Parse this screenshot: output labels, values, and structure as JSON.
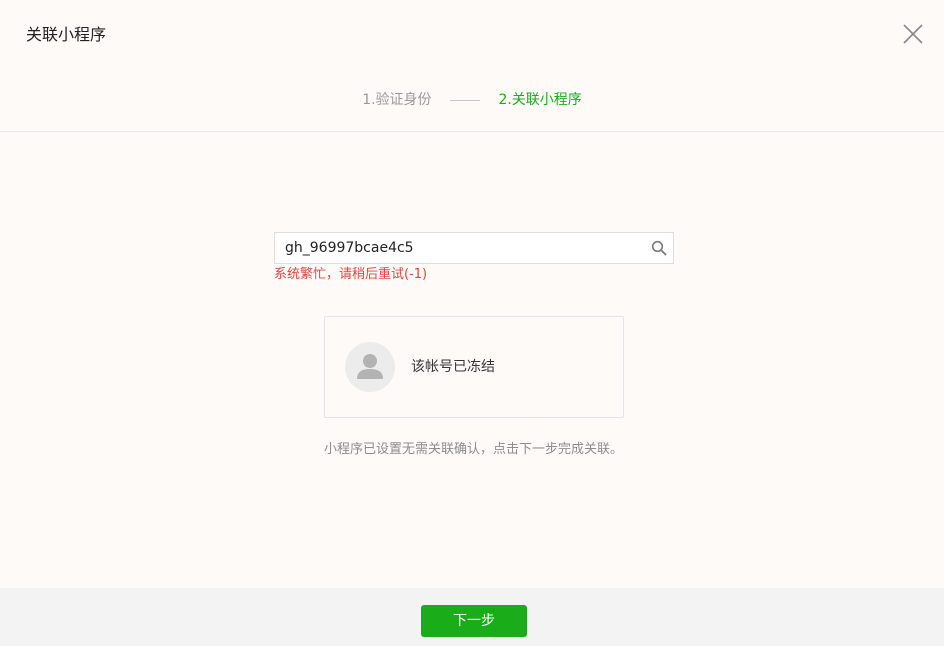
{
  "dialog": {
    "title": "关联小程序",
    "close_icon": "close-icon"
  },
  "steps": [
    {
      "label": "1.验证身份",
      "active": false
    },
    {
      "label": "2.关联小程序",
      "active": true
    }
  ],
  "search": {
    "value": "gh_96997bcae4c5",
    "placeholder": "",
    "icon": "search-icon"
  },
  "error": {
    "text": "系统繁忙，请稍后重试(-1)"
  },
  "account_card": {
    "avatar_icon": "user-avatar-icon",
    "text": "该帐号已冻结"
  },
  "hint": {
    "text": "小程序已设置无需关联确认，点击下一步完成关联。"
  },
  "footer": {
    "next_label": "下一步"
  },
  "colors": {
    "accent": "#1aad19",
    "error": "#e64340",
    "background": "#fdfaf7",
    "footer": "#f3f3f3"
  }
}
